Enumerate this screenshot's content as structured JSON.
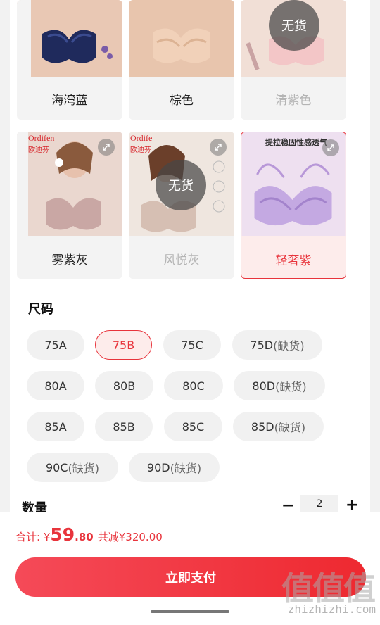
{
  "colors": [
    {
      "label": "海湾蓝",
      "state": "normal",
      "photo_tone": "#1f2a5c"
    },
    {
      "label": "棕色",
      "state": "normal",
      "photo_tone": "#e9c7ae"
    },
    {
      "label": "清紫色",
      "state": "disabled",
      "badge": "无货",
      "photo_tone": "#f3c6c7"
    },
    {
      "label": "雾紫灰",
      "state": "normal",
      "brand": "Ordifen",
      "brand_sub": "欧迪芬",
      "photo_tone": "#c9a7a4"
    },
    {
      "label": "风悦灰",
      "state": "disabled",
      "badge": "无货",
      "brand": "Ordife",
      "brand_sub": "欧迪芬",
      "photo_tone": "#d6bfb3"
    },
    {
      "label": "轻奢紫",
      "state": "selected",
      "caption": "提拉稳固性感透气",
      "photo_tone": "#c4a9e2"
    }
  ],
  "size": {
    "title": "尺码",
    "options": [
      {
        "label": "75A",
        "oos": ""
      },
      {
        "label": "75B",
        "oos": "",
        "selected": true
      },
      {
        "label": "75C",
        "oos": ""
      },
      {
        "label": "75D",
        "oos": "(缺货)"
      },
      {
        "label": "80A",
        "oos": ""
      },
      {
        "label": "80B",
        "oos": ""
      },
      {
        "label": "80C",
        "oos": ""
      },
      {
        "label": "80D",
        "oos": "(缺货)"
      },
      {
        "label": "85A",
        "oos": ""
      },
      {
        "label": "85B",
        "oos": ""
      },
      {
        "label": "85C",
        "oos": ""
      },
      {
        "label": "85D",
        "oos": "(缺货)"
      },
      {
        "label": "90C",
        "oos": "(缺货)"
      },
      {
        "label": "90D",
        "oos": "(缺货)"
      }
    ]
  },
  "quantity": {
    "title": "数量",
    "minus": "−",
    "value": "2",
    "plus": "+"
  },
  "footer": {
    "total_label": "合计: ",
    "currency": "¥",
    "price_int": "59",
    "price_dec": ".80",
    "saving": "共减¥320.00",
    "pay_button": "立即支付"
  },
  "watermark": {
    "text": "值值值",
    "url": "zhizhizhi.com"
  },
  "accent": "#e8343c"
}
